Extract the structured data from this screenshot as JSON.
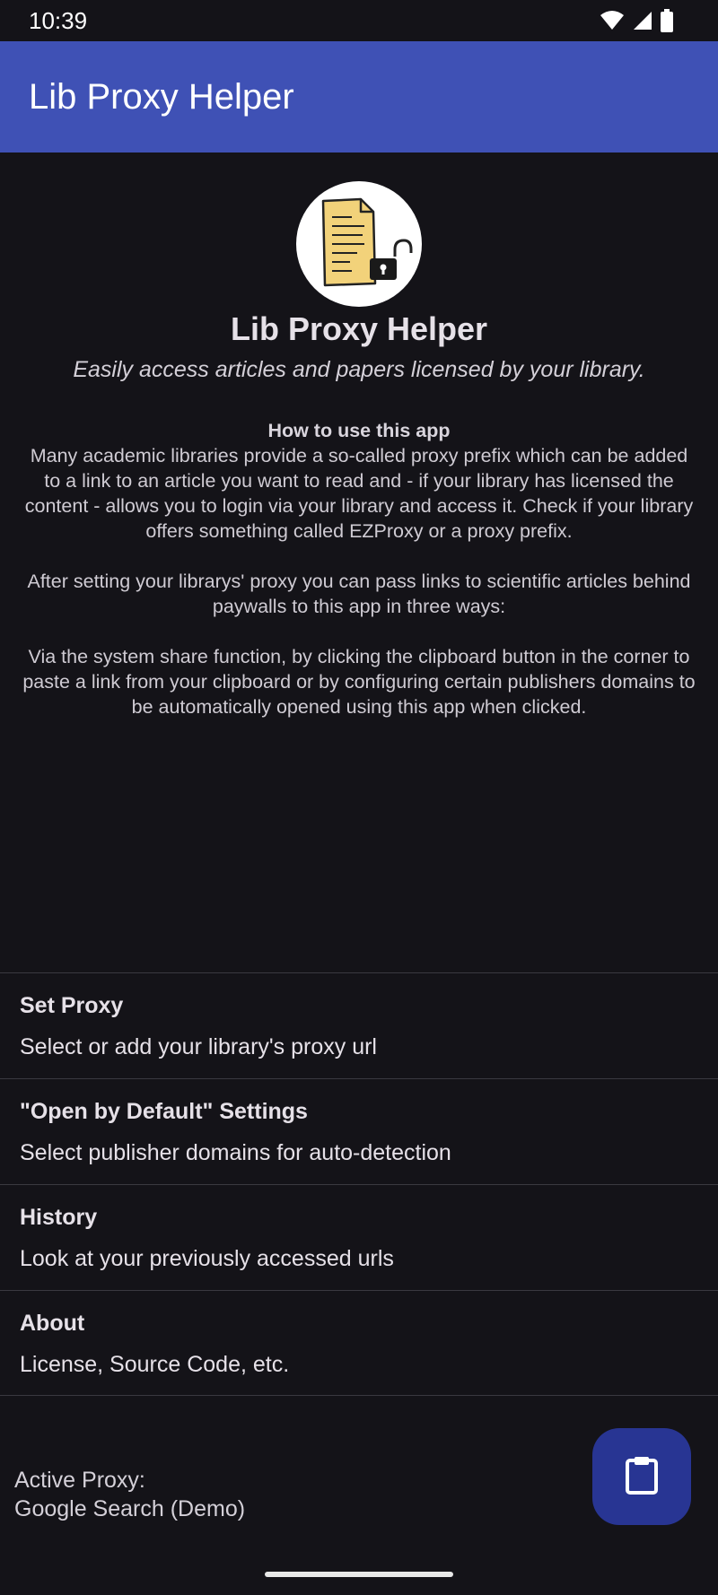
{
  "status_bar": {
    "time": "10:39",
    "icons": [
      "wifi-icon",
      "signal-icon",
      "battery-icon"
    ]
  },
  "app_bar": {
    "title": "Lib Proxy Helper",
    "color": "#3f51b5"
  },
  "hero": {
    "logo": "document-unlocked-icon",
    "title": "Lib Proxy Helper",
    "subtitle": "Easily access articles and papers licensed by your library."
  },
  "how_to": {
    "heading": "How to use this app",
    "paragraph1": "Many academic libraries provide a so-called proxy prefix which can be added to a link to an article you want to read and - if your library has licensed the content - allows you to login via your library and access it. Check if your library offers something called EZProxy or a proxy prefix.",
    "paragraph2": "After setting your librarys' proxy you can pass links to scientific articles behind paywalls to this app in three ways:",
    "paragraph3": "Via the system share function, by clicking the clipboard button in the corner to paste a link from your clipboard or by configuring certain publishers domains to be automatically opened using this app when clicked."
  },
  "menu": {
    "items": [
      {
        "title": "Set Proxy",
        "subtitle": "Select or add your library's proxy url"
      },
      {
        "title": "\"Open by Default\" Settings",
        "subtitle": "Select publisher domains for auto-detection"
      },
      {
        "title": "History",
        "subtitle": "Look at your previously accessed urls"
      },
      {
        "title": "About",
        "subtitle": "License, Source Code, etc."
      }
    ]
  },
  "footer": {
    "active_proxy_label": "Active Proxy:",
    "active_proxy_value": "Google Search (Demo)"
  },
  "fab": {
    "icon": "clipboard-icon",
    "color": "#283593"
  }
}
